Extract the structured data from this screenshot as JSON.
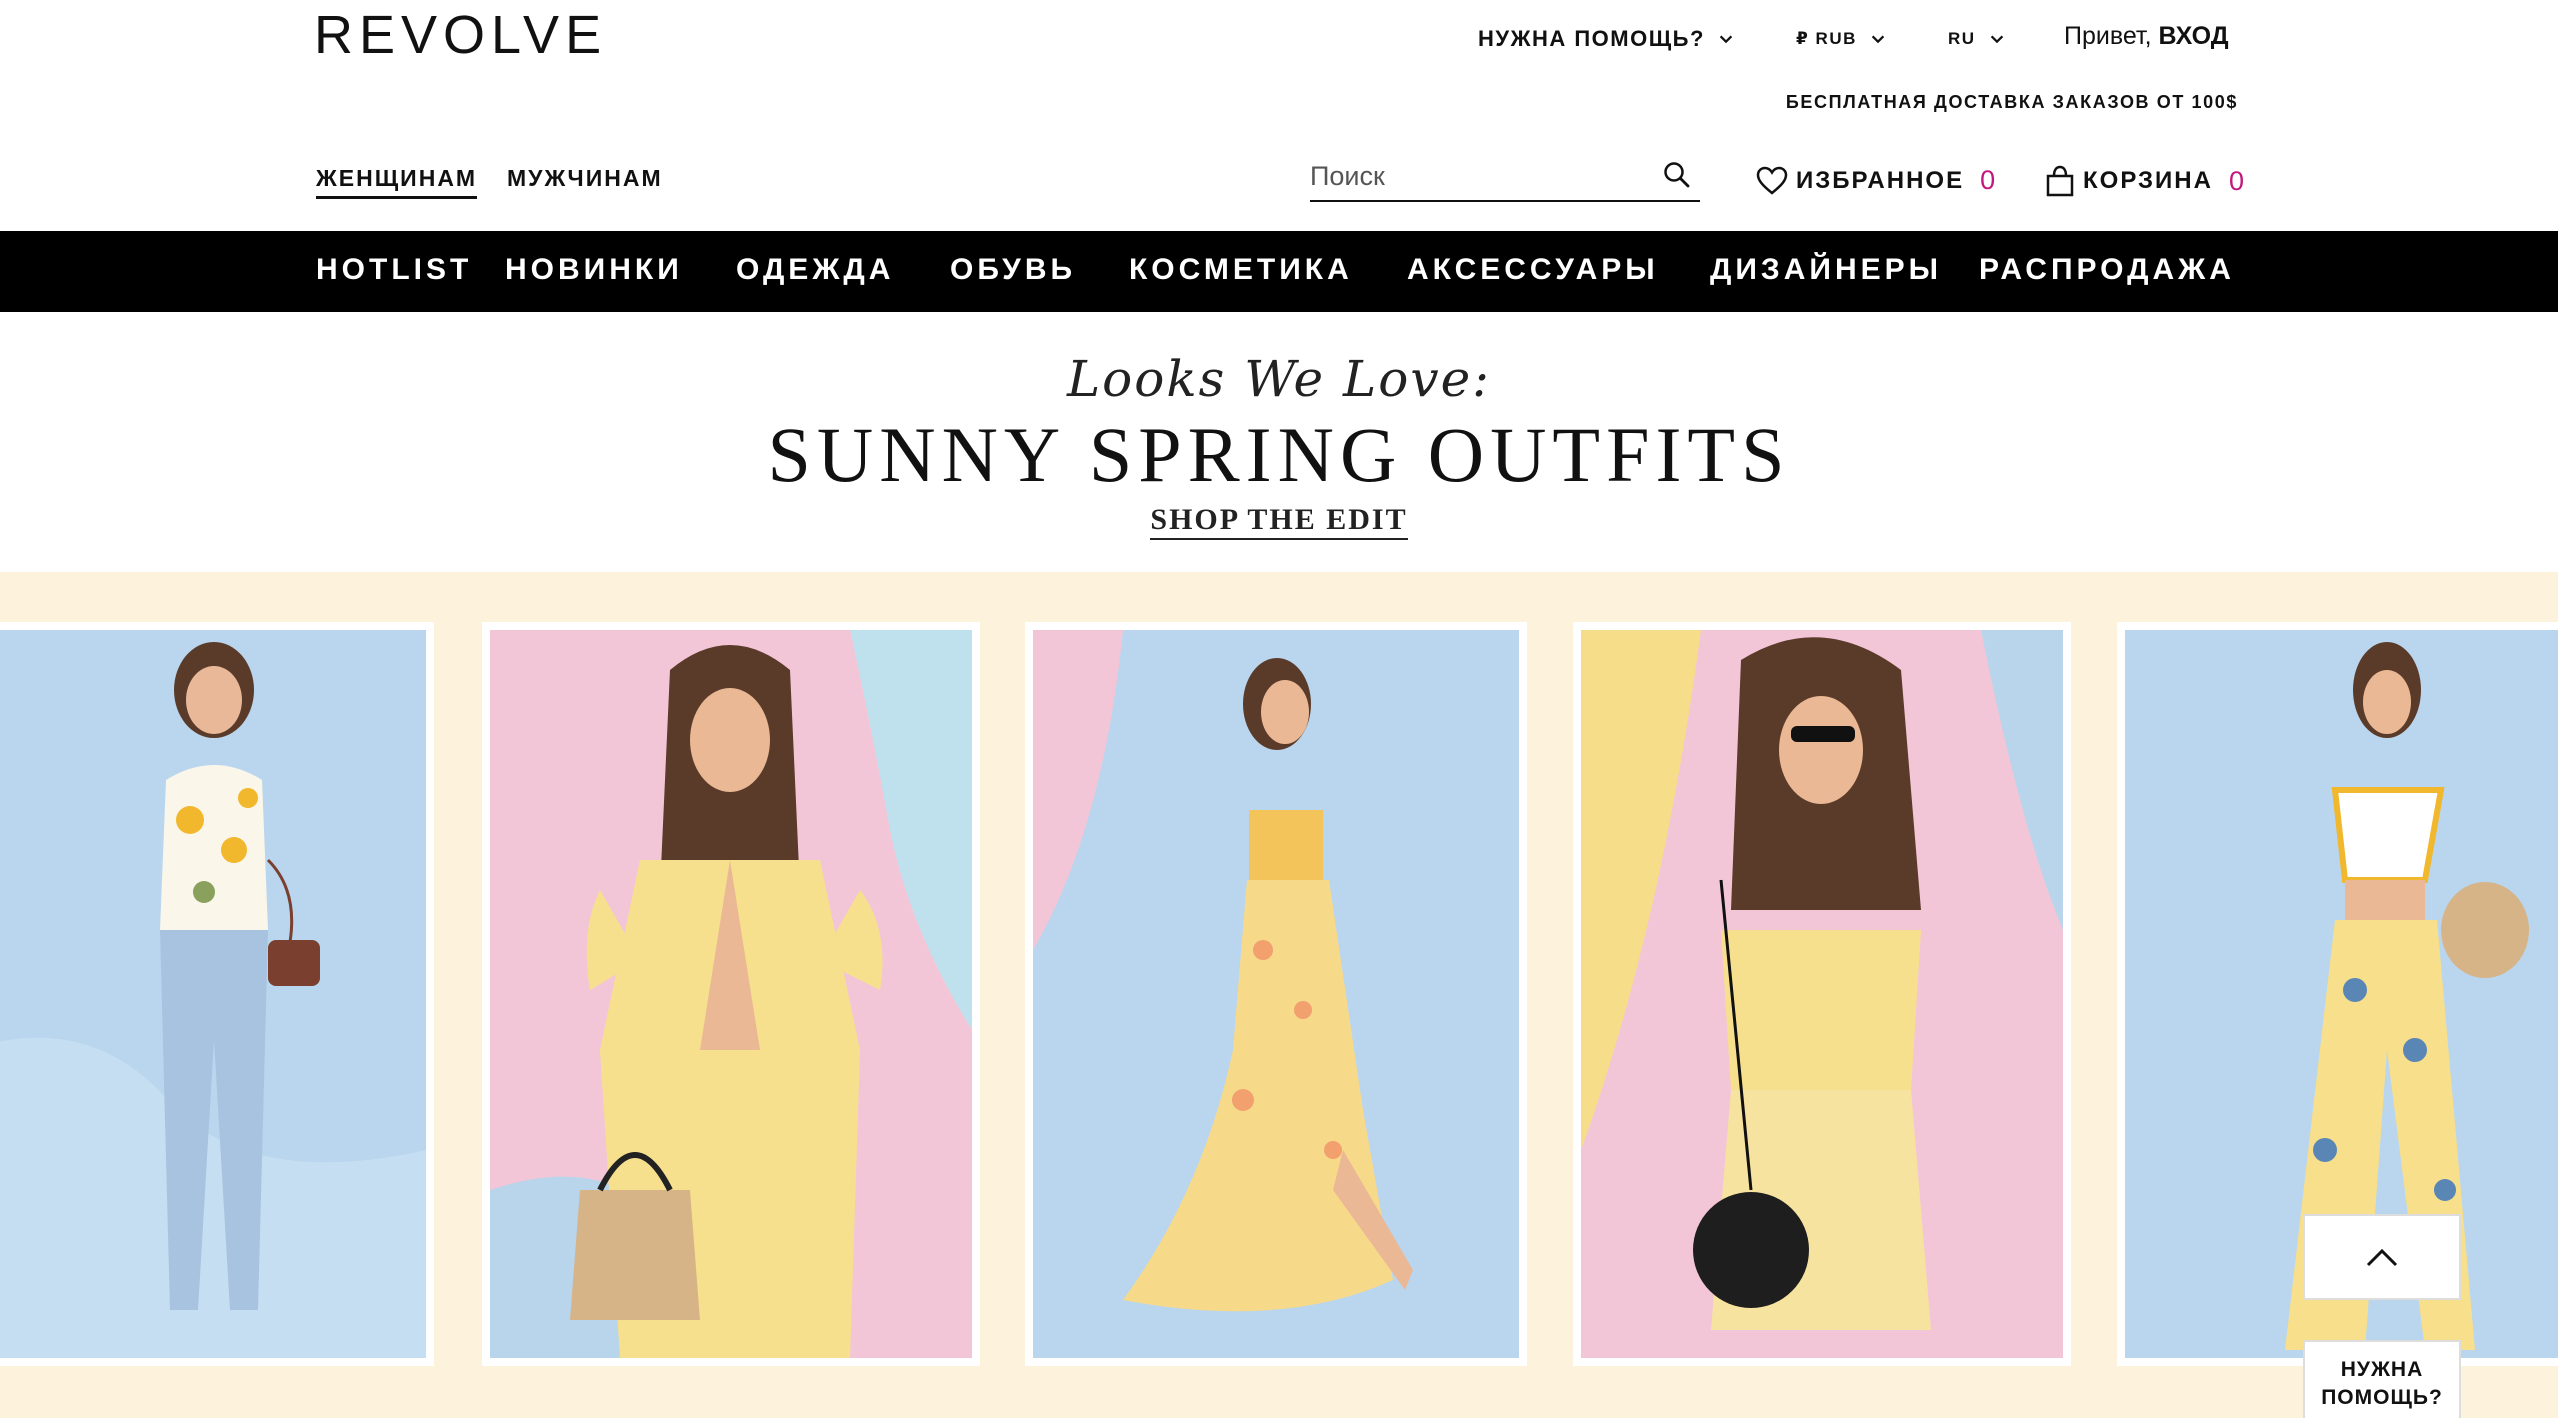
{
  "header": {
    "logo": "REVOLVE",
    "help": "НУЖНА ПОМОЩЬ?",
    "currency": "₽ RUB",
    "language": "RU",
    "greeting_prefix": "Привет,",
    "login": "ВХОД",
    "free_shipping": "БЕСПЛАТНАЯ ДОСТАВКА ЗАКАЗОВ ОТ 100$",
    "gender_tabs": [
      {
        "label": "ЖЕНЩИНАМ",
        "active": true
      },
      {
        "label": "МУЖЧИНАМ",
        "active": false
      }
    ],
    "search_placeholder": "Поиск",
    "wishlist_label": "ИЗБРАННОЕ",
    "wishlist_count": "0",
    "cart_label": "КОРЗИНА",
    "cart_count": "0"
  },
  "categories": [
    "HOTLIST",
    "НОВИНКИ",
    "ОДЕЖДА",
    "ОБУВЬ",
    "КОСМЕТИКА",
    "АКСЕССУАРЫ",
    "ДИЗАЙНЕРЫ",
    "РАСПРОДАЖА"
  ],
  "hero": {
    "kicker": "Looks We Love:",
    "title": "SUNNY SPRING OUTFITS",
    "cta": "SHOP THE EDIT"
  },
  "widgets": {
    "help_chat": "НУЖНА ПОМОЩЬ?"
  },
  "colors": {
    "accent_count": "#c2187e",
    "category_bar": "#000000",
    "banner_bg": "#fdf3dd",
    "sky_blue": "#b9d6ee",
    "pink": "#f3c6d7",
    "yellow": "#f6dd8a"
  },
  "icons": [
    "chevron-down-icon",
    "search-icon",
    "heart-icon",
    "shopping-bag-icon",
    "chevron-up-icon"
  ]
}
